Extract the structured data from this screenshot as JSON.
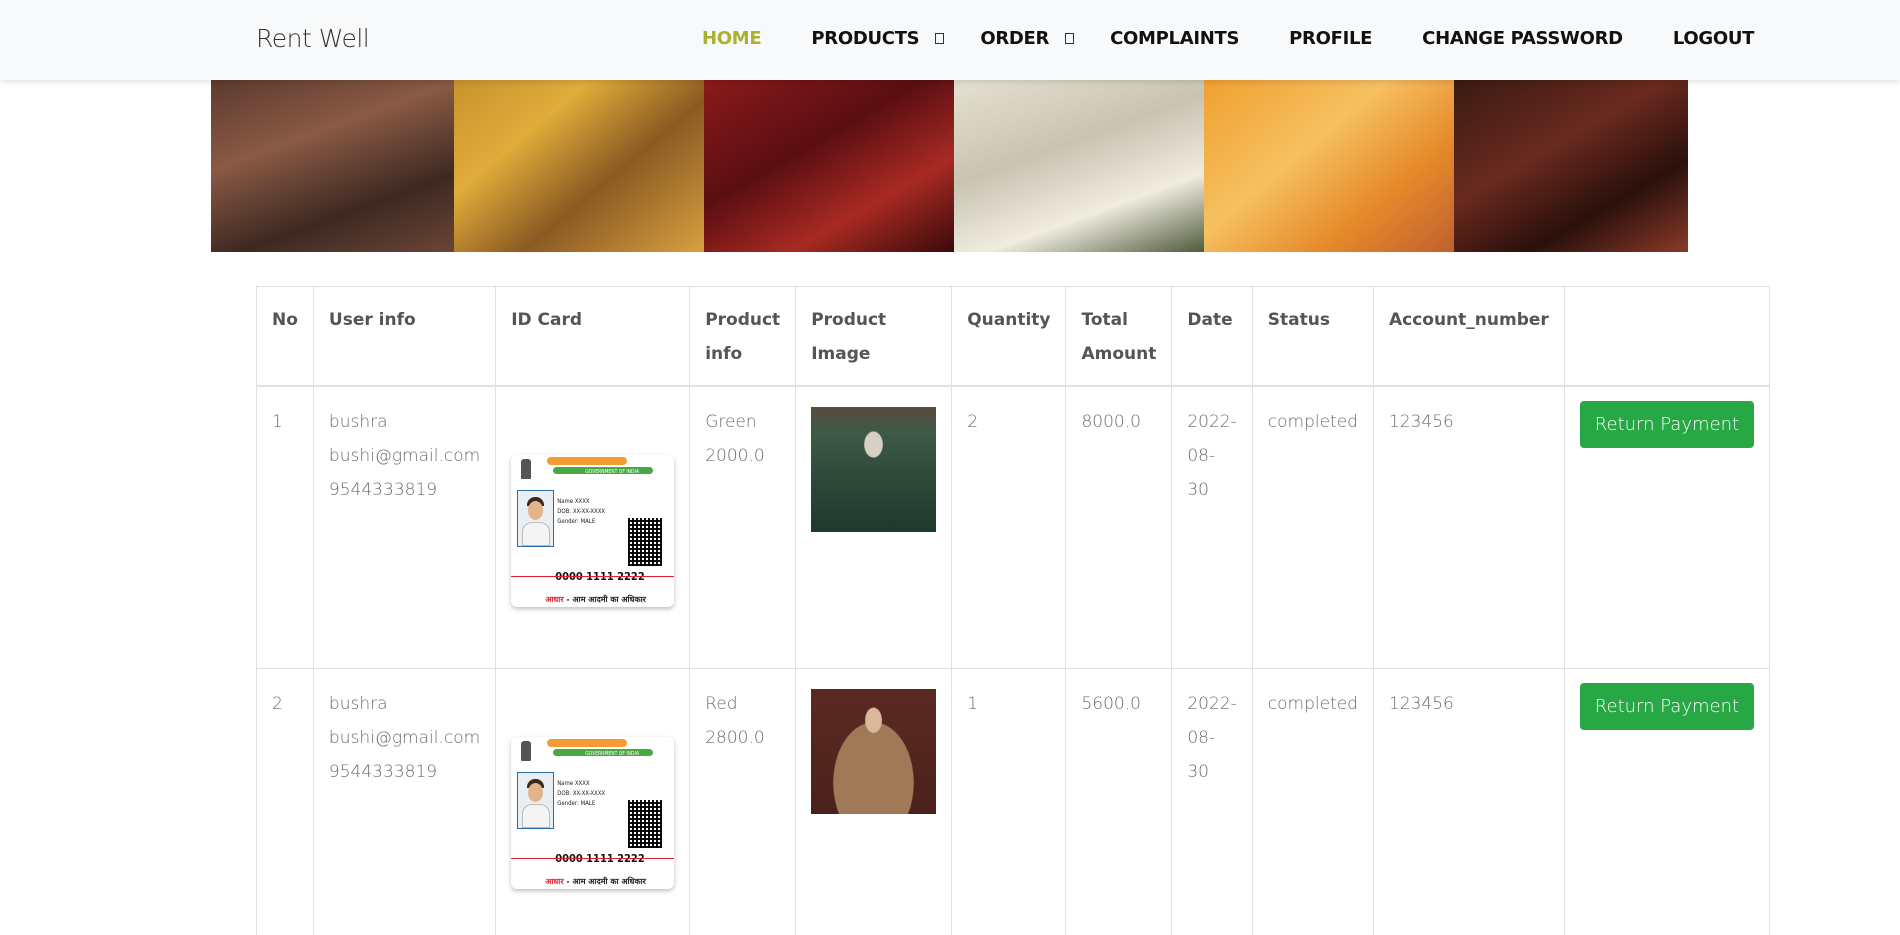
{
  "brand": "Rent Well",
  "nav": [
    {
      "label": "HOME",
      "active": true,
      "dropdown": false
    },
    {
      "label": "PRODUCTS",
      "active": false,
      "dropdown": true
    },
    {
      "label": "ORDER",
      "active": false,
      "dropdown": true
    },
    {
      "label": "COMPLAINTS",
      "active": false,
      "dropdown": false
    },
    {
      "label": "PROFILE",
      "active": false,
      "dropdown": false
    },
    {
      "label": "CHANGE PASSWORD",
      "active": false,
      "dropdown": false
    },
    {
      "label": "LOGOUT",
      "active": false,
      "dropdown": false
    }
  ],
  "colors": {
    "accent": "#a8b130",
    "button": "#28a745"
  },
  "table": {
    "headers": [
      "No",
      "User info",
      "ID Card",
      "Product info",
      "Product Image",
      "Quantity",
      "Total Amount",
      "Date",
      "Status",
      "Account_number",
      ""
    ],
    "rows": [
      {
        "no": "1",
        "user_name": "bushra",
        "user_email": "bushi@gmail.com",
        "user_phone": "9544333819",
        "id_card": {
          "number": "0000 1111 2222",
          "name": "Name XXXX",
          "dob": "DOB: XX-XX-XXXX",
          "gender": "Gender: MALE",
          "gov": "GOVERNMENT OF INDIA"
        },
        "product_color": "Green",
        "product_price": "2000.0",
        "quantity": "2",
        "total": "8000.0",
        "date_1": "2022-",
        "date_2": "08-",
        "date_3": "30",
        "status": "completed",
        "account": "123456",
        "action": "Return Payment"
      },
      {
        "no": "2",
        "user_name": "bushra",
        "user_email": "bushi@gmail.com",
        "user_phone": "9544333819",
        "id_card": {
          "number": "0000 1111 2222",
          "name": "Name XXXX",
          "dob": "DOB: XX-XX-XXXX",
          "gender": "Gender: MALE",
          "gov": "GOVERNMENT OF INDIA"
        },
        "product_color": "Red",
        "product_price": "2800.0",
        "quantity": "1",
        "total": "5600.0",
        "date_1": "2022-",
        "date_2": "08-",
        "date_3": "30",
        "status": "completed",
        "account": "123456",
        "action": "Return Payment"
      }
    ]
  }
}
